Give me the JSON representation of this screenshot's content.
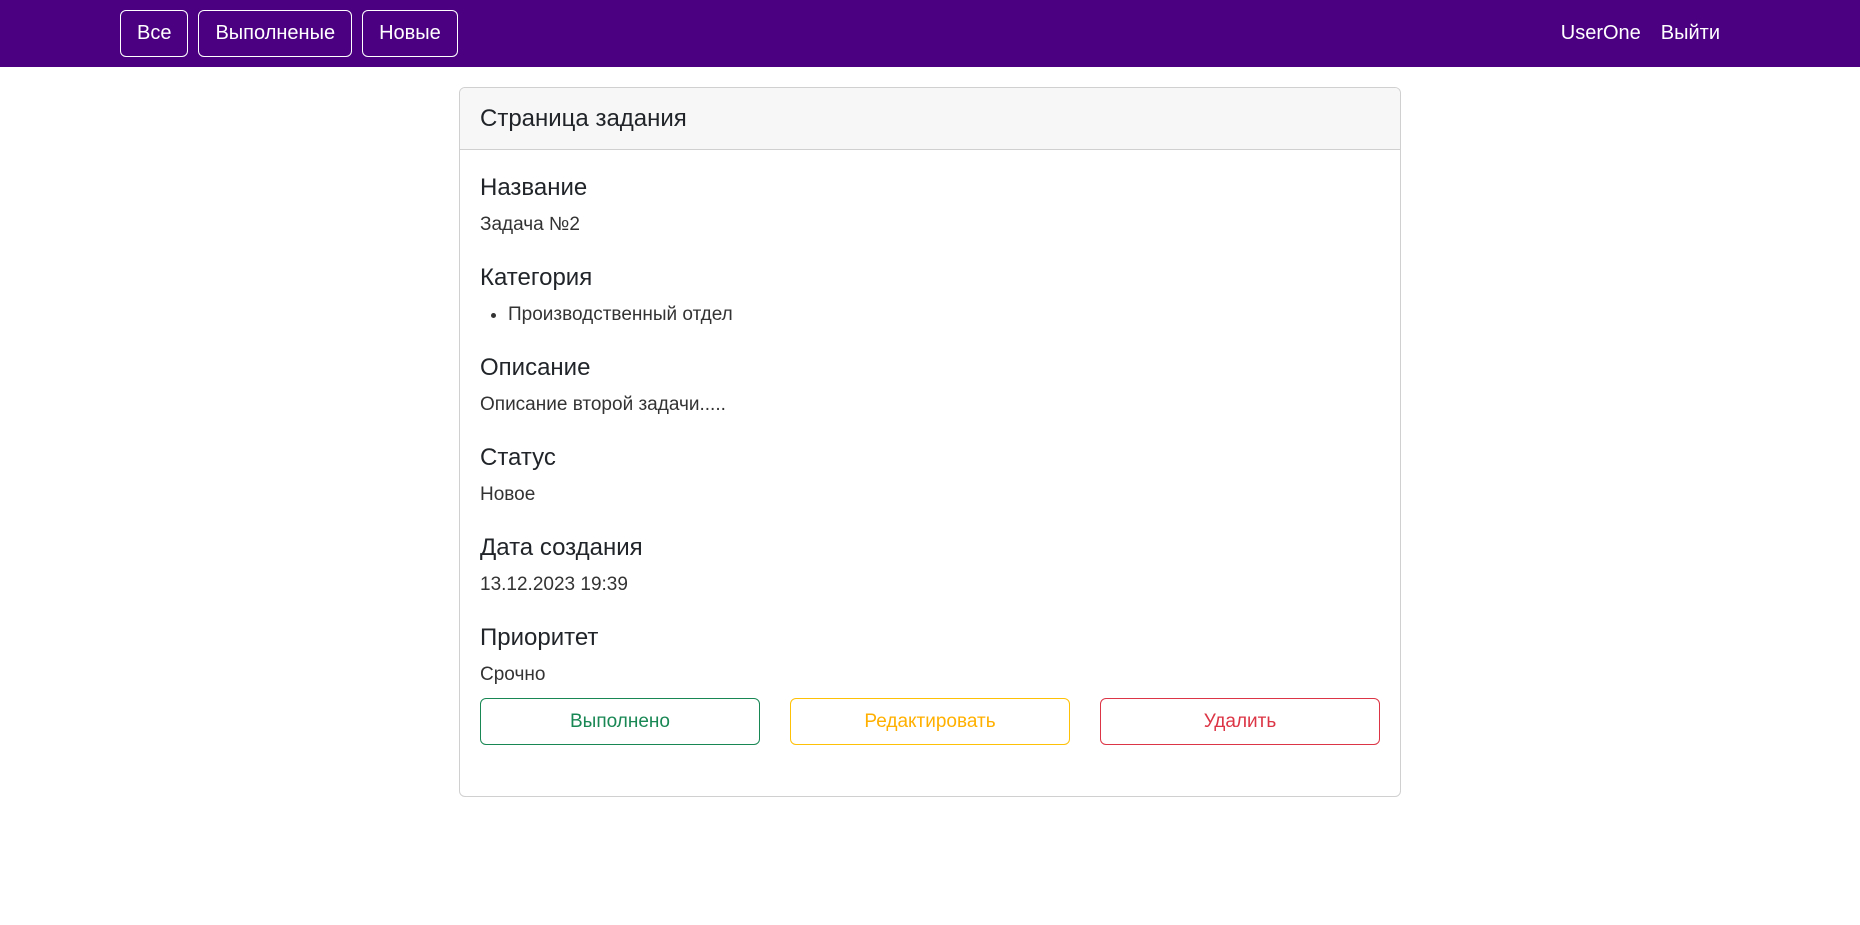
{
  "navbar": {
    "filters": [
      "Все",
      "Выполненые",
      "Новые"
    ],
    "username": "UserOne",
    "logout": "Выйти"
  },
  "card": {
    "header": "Страница задания",
    "fields": {
      "name_label": "Название",
      "name_value": "Задача №2",
      "category_label": "Категория",
      "category_items": [
        "Производственный отдел"
      ],
      "description_label": "Описание",
      "description_value": "Описание второй задачи.....",
      "status_label": "Статус",
      "status_value": "Новое",
      "created_label": "Дата создания",
      "created_value": "13.12.2023 19:39",
      "priority_label": "Приоритет",
      "priority_value": "Срочно"
    },
    "actions": {
      "done": "Выполнено",
      "edit": "Редактировать",
      "delete": "Удалить"
    }
  },
  "colors": {
    "navbar_bg": "#4b0082",
    "success": "#198754",
    "warning": "#ffc107",
    "danger": "#dc3545"
  }
}
